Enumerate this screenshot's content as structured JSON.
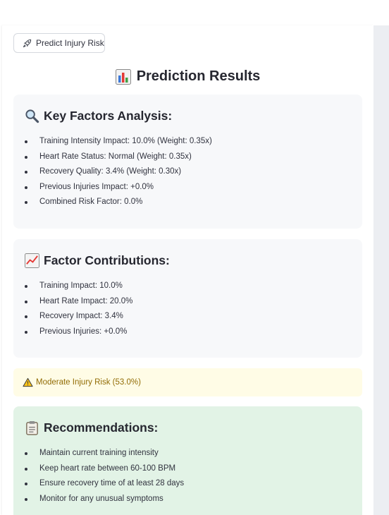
{
  "predict_button": {
    "label": "Predict Injury Risk",
    "icon": "rocket-icon"
  },
  "results_title": {
    "text": "Prediction Results",
    "icon": "bar-chart-icon"
  },
  "key_factors": {
    "heading": "Key Factors Analysis:",
    "icon": "magnifier-icon",
    "items": [
      "Training Intensity Impact: 10.0% (Weight: 0.35x)",
      "Heart Rate Status: Normal (Weight: 0.35x)",
      "Recovery Quality: 3.4% (Weight: 0.30x)",
      "Previous Injuries Impact: +0.0%",
      "Combined Risk Factor: 0.0%"
    ]
  },
  "factor_contributions": {
    "heading": "Factor Contributions:",
    "icon": "trend-chart-icon",
    "items": [
      "Training Impact: 10.0%",
      "Heart Rate Impact: 20.0%",
      "Recovery Impact: 3.4%",
      "Previous Injuries: +0.0%"
    ]
  },
  "risk_alert": {
    "text": "Moderate Injury Risk (53.0%)",
    "icon": "warning-icon",
    "color": "#926c05"
  },
  "recommendations": {
    "heading": "Recommendations:",
    "icon": "clipboard-icon",
    "items": [
      "Maintain current training intensity",
      "Keep heart rate between 60-100 BPM",
      "Ensure recovery time of at least 28 days",
      "Monitor for any unusual symptoms"
    ]
  }
}
